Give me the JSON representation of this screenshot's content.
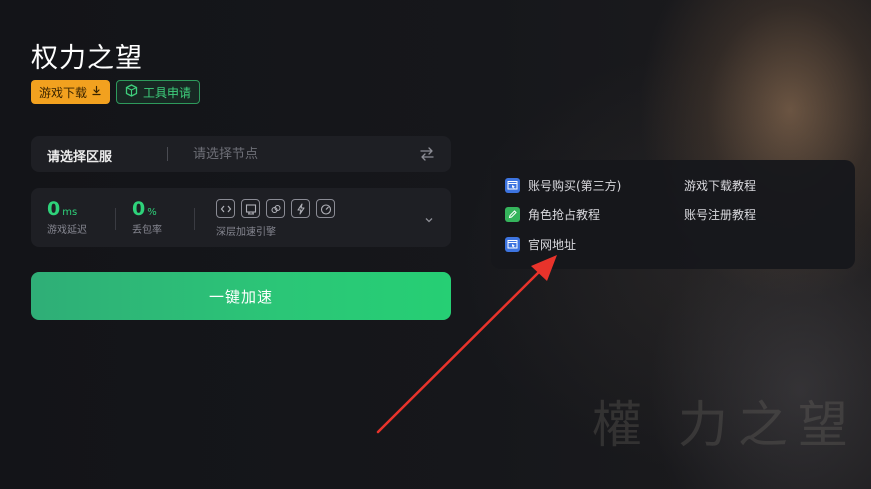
{
  "game": {
    "title": "权力之望",
    "watermark": "權 力之望"
  },
  "buttons": {
    "download_label": "游戏下载",
    "tool_apply_label": "工具申请",
    "accelerate_label": "一键加速"
  },
  "server_select": {
    "label": "请选择区服",
    "node_placeholder": "请选择节点"
  },
  "stats": {
    "latency": {
      "value": "0",
      "unit": "ms",
      "label": "游戏延迟"
    },
    "packet_loss": {
      "value": "0",
      "unit": "%",
      "label": "丢包率"
    },
    "engine_label": "深层加速引擎",
    "engine_icons": [
      "code-icon",
      "screen-icon",
      "link-icon",
      "lightning-icon",
      "speedometer-icon"
    ]
  },
  "links": [
    {
      "label": "账号购买(第三方)",
      "icon": "window-cursor-icon",
      "icon_color": "#3d74e0"
    },
    {
      "label": "游戏下载教程",
      "icon": "",
      "icon_color": ""
    },
    {
      "label": "角色抢占教程",
      "icon": "pencil-icon",
      "icon_color": "#35b45c"
    },
    {
      "label": "账号注册教程",
      "icon": "",
      "icon_color": ""
    },
    {
      "label": "官网地址",
      "icon": "window-cursor-icon",
      "icon_color": "#3d74e0"
    }
  ],
  "colors": {
    "accent_green": "#2ed27a",
    "download_orange": "#f2a11f",
    "annotation_red": "#e8332b"
  }
}
